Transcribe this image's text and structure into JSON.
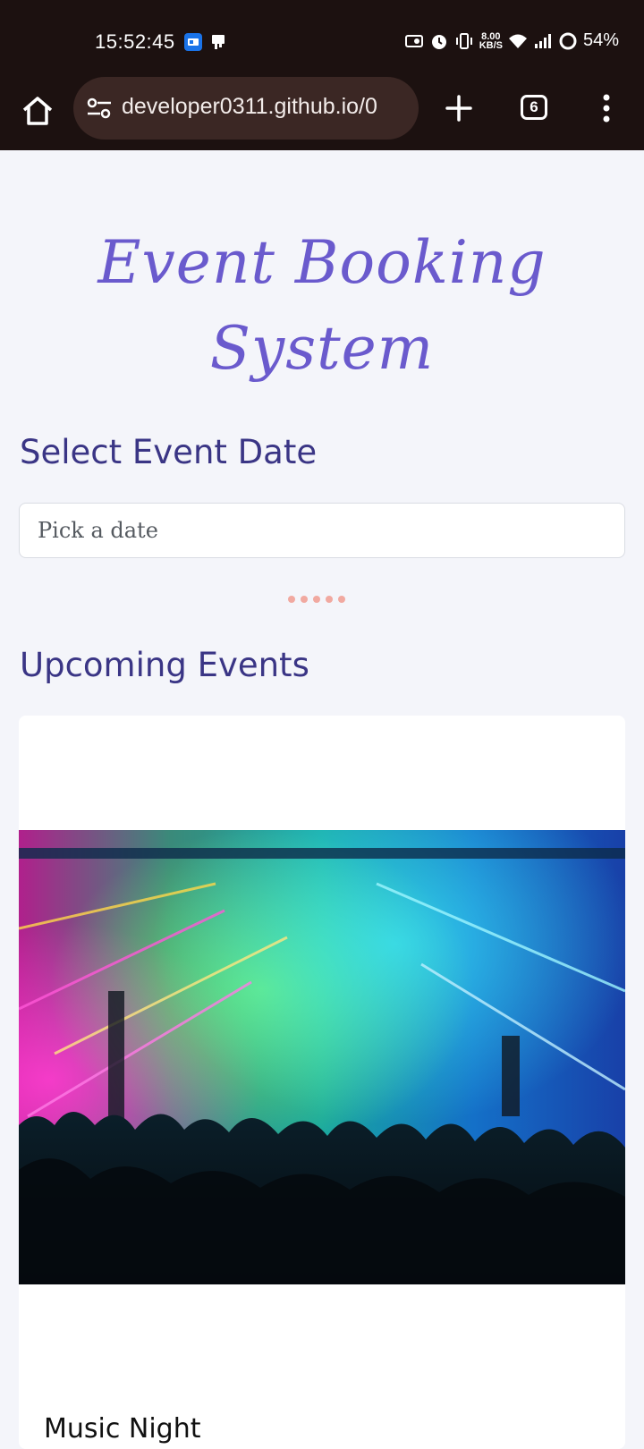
{
  "status_bar": {
    "time": "15:52:45",
    "net_speed_value": "8.00",
    "net_speed_unit": "KB/S",
    "battery": "54%"
  },
  "browser": {
    "url": "developer0311.github.io/0",
    "tab_count": "6"
  },
  "page": {
    "title_line1": "Event Booking",
    "title_line2": "System",
    "date_section_heading": "Select Event Date",
    "date_input_placeholder": "Pick a date",
    "events_heading": "Upcoming Events",
    "events": [
      {
        "title": "Music Night"
      }
    ]
  },
  "colors": {
    "title": "#6a5acd",
    "heading": "#3a3585",
    "browser_bar": "#1c1110",
    "url_pill": "#3b2724",
    "loader_dots": "#f1a9a0"
  },
  "icons": [
    "home-icon",
    "site-settings-icon",
    "plus-icon",
    "more-vert-icon",
    "alarm-icon",
    "vibrate-icon",
    "wifi-icon",
    "signal-icon"
  ]
}
